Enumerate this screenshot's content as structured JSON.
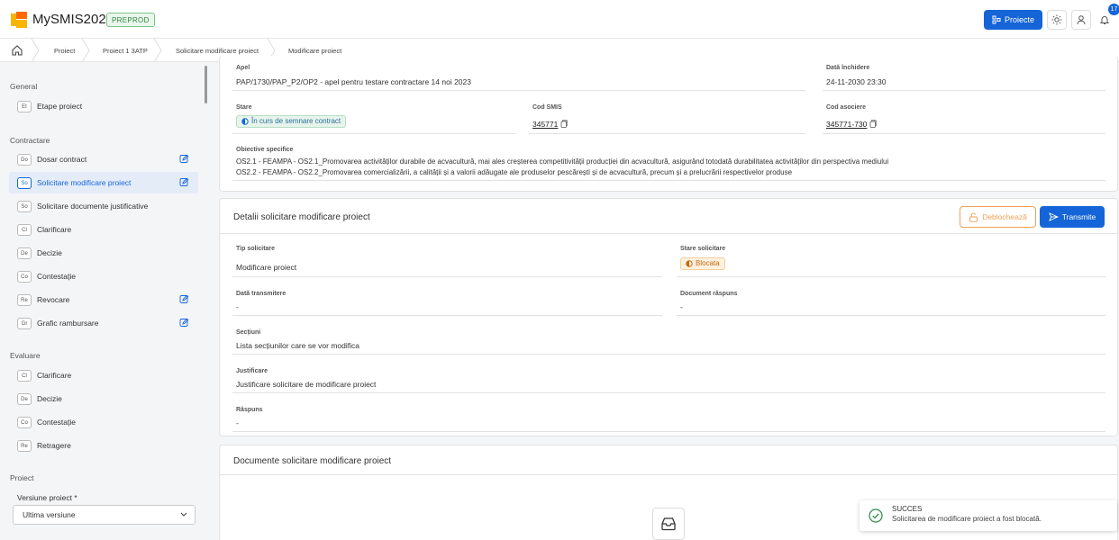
{
  "app": {
    "name": "MySMIS2021",
    "env": "PREPROD"
  },
  "header": {
    "projects_label": "Proiecte",
    "notification_count": "17"
  },
  "breadcrumbs": [
    "Proiect",
    "Proiect 1 3ATP",
    "Solicitare modificare proiect",
    "Modificare proiect"
  ],
  "sidebar": {
    "general_title": "General",
    "general_items": [
      {
        "abbr": "Et",
        "label": "Etape proiect"
      }
    ],
    "contractare_title": "Contractare",
    "contractare_items": [
      {
        "abbr": "Do",
        "label": "Dosar contract"
      },
      {
        "abbr": "So",
        "label": "Solicitare modificare proiect"
      },
      {
        "abbr": "So",
        "label": "Solicitare documente justificative"
      },
      {
        "abbr": "Cl",
        "label": "Clarificare"
      },
      {
        "abbr": "De",
        "label": "Decizie"
      },
      {
        "abbr": "Co",
        "label": "Contestație"
      },
      {
        "abbr": "Re",
        "label": "Revocare"
      },
      {
        "abbr": "Gr",
        "label": "Grafic rambursare"
      }
    ],
    "evaluare_title": "Evaluare",
    "evaluare_items": [
      {
        "abbr": "Cl",
        "label": "Clarificare"
      },
      {
        "abbr": "De",
        "label": "Decizie"
      },
      {
        "abbr": "Co",
        "label": "Contestație"
      },
      {
        "abbr": "Re",
        "label": "Retragere"
      }
    ],
    "proiect_title": "Proiect",
    "version_label": "Versiune proiect *",
    "version_value": "Ultima versiune"
  },
  "project_info": {
    "apel_label": "Apel",
    "apel_value": "PAP/1730/PAP_P2/OP2 - apel pentru testare contractare 14 noi 2023",
    "closing_label": "Dată închidere",
    "closing_value": "24-11-2030 23:30",
    "stare_label": "Stare",
    "stare_value": "În curs de semnare contract",
    "smis_label": "Cod SMIS",
    "smis_value": "345771",
    "assoc_label": "Cod asociere",
    "assoc_value": "345771-730",
    "objectives_label": "Obiective specifice",
    "objectives": [
      "OS2.1 - FEAMPA - OS2.1_Promovarea activităților durabile de acvacultură, mai ales creșterea competitivității producției din acvacultură, asigurând totodată durabilitatea activităților din perspectiva mediului",
      "OS2.2 - FEAMPA - OS2.2_Promovarea comercializării, a calității și a valorii adăugate ale produselor pescărești și de acvacultură, precum și a prelucrării respectivelor produse"
    ]
  },
  "request_details": {
    "title": "Detalii solicitare modificare proiect",
    "unlock_label": "Deblochează",
    "send_label": "Transmite",
    "type_label": "Tip solicitare",
    "type_value": "Modificare proiect",
    "status_label": "Stare solicitare",
    "status_value": "Blocata",
    "sent_label": "Dată transmitere",
    "sent_value": "-",
    "doc_label": "Document răspuns",
    "doc_value": "-",
    "sections_label": "Secțiuni",
    "sections_value": "Lista secțiunilor care se vor modifica",
    "justification_label": "Justificare",
    "justification_value": "Justificare solicitare de modificare proiect",
    "answer_label": "Răspuns",
    "answer_value": "-"
  },
  "documents": {
    "title": "Documente solicitare modificare proiect"
  },
  "toast": {
    "title": "SUCCES",
    "message": "Solicitarea de modificare proiect a fost blocată."
  },
  "colors": {
    "primary": "#1565d8",
    "warning": "#f0a254",
    "success": "#2f8a44",
    "status_active": "#1565d8"
  }
}
